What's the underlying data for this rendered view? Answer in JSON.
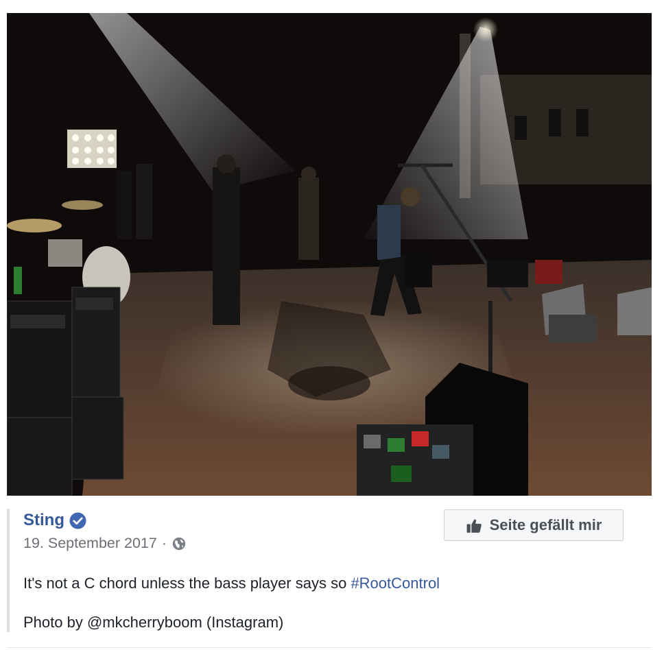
{
  "post": {
    "author": "Sting",
    "date": "19. September 2017",
    "separator": "·",
    "visibility_icon": "globe-icon",
    "verified_icon": "verified-badge-icon",
    "caption_text": "It's not a C chord unless the bass player says so ",
    "caption_hashtag": "#RootControl",
    "credit": "Photo by @mkcherryboom (Instagram)"
  },
  "like_button": {
    "label": "Seite gefällt mir",
    "icon": "thumbs-up-icon"
  },
  "colors": {
    "link_blue": "#365899",
    "verified_blue": "#4267b2",
    "meta_gray": "#6b6f75",
    "text_dark": "#1d2129"
  }
}
